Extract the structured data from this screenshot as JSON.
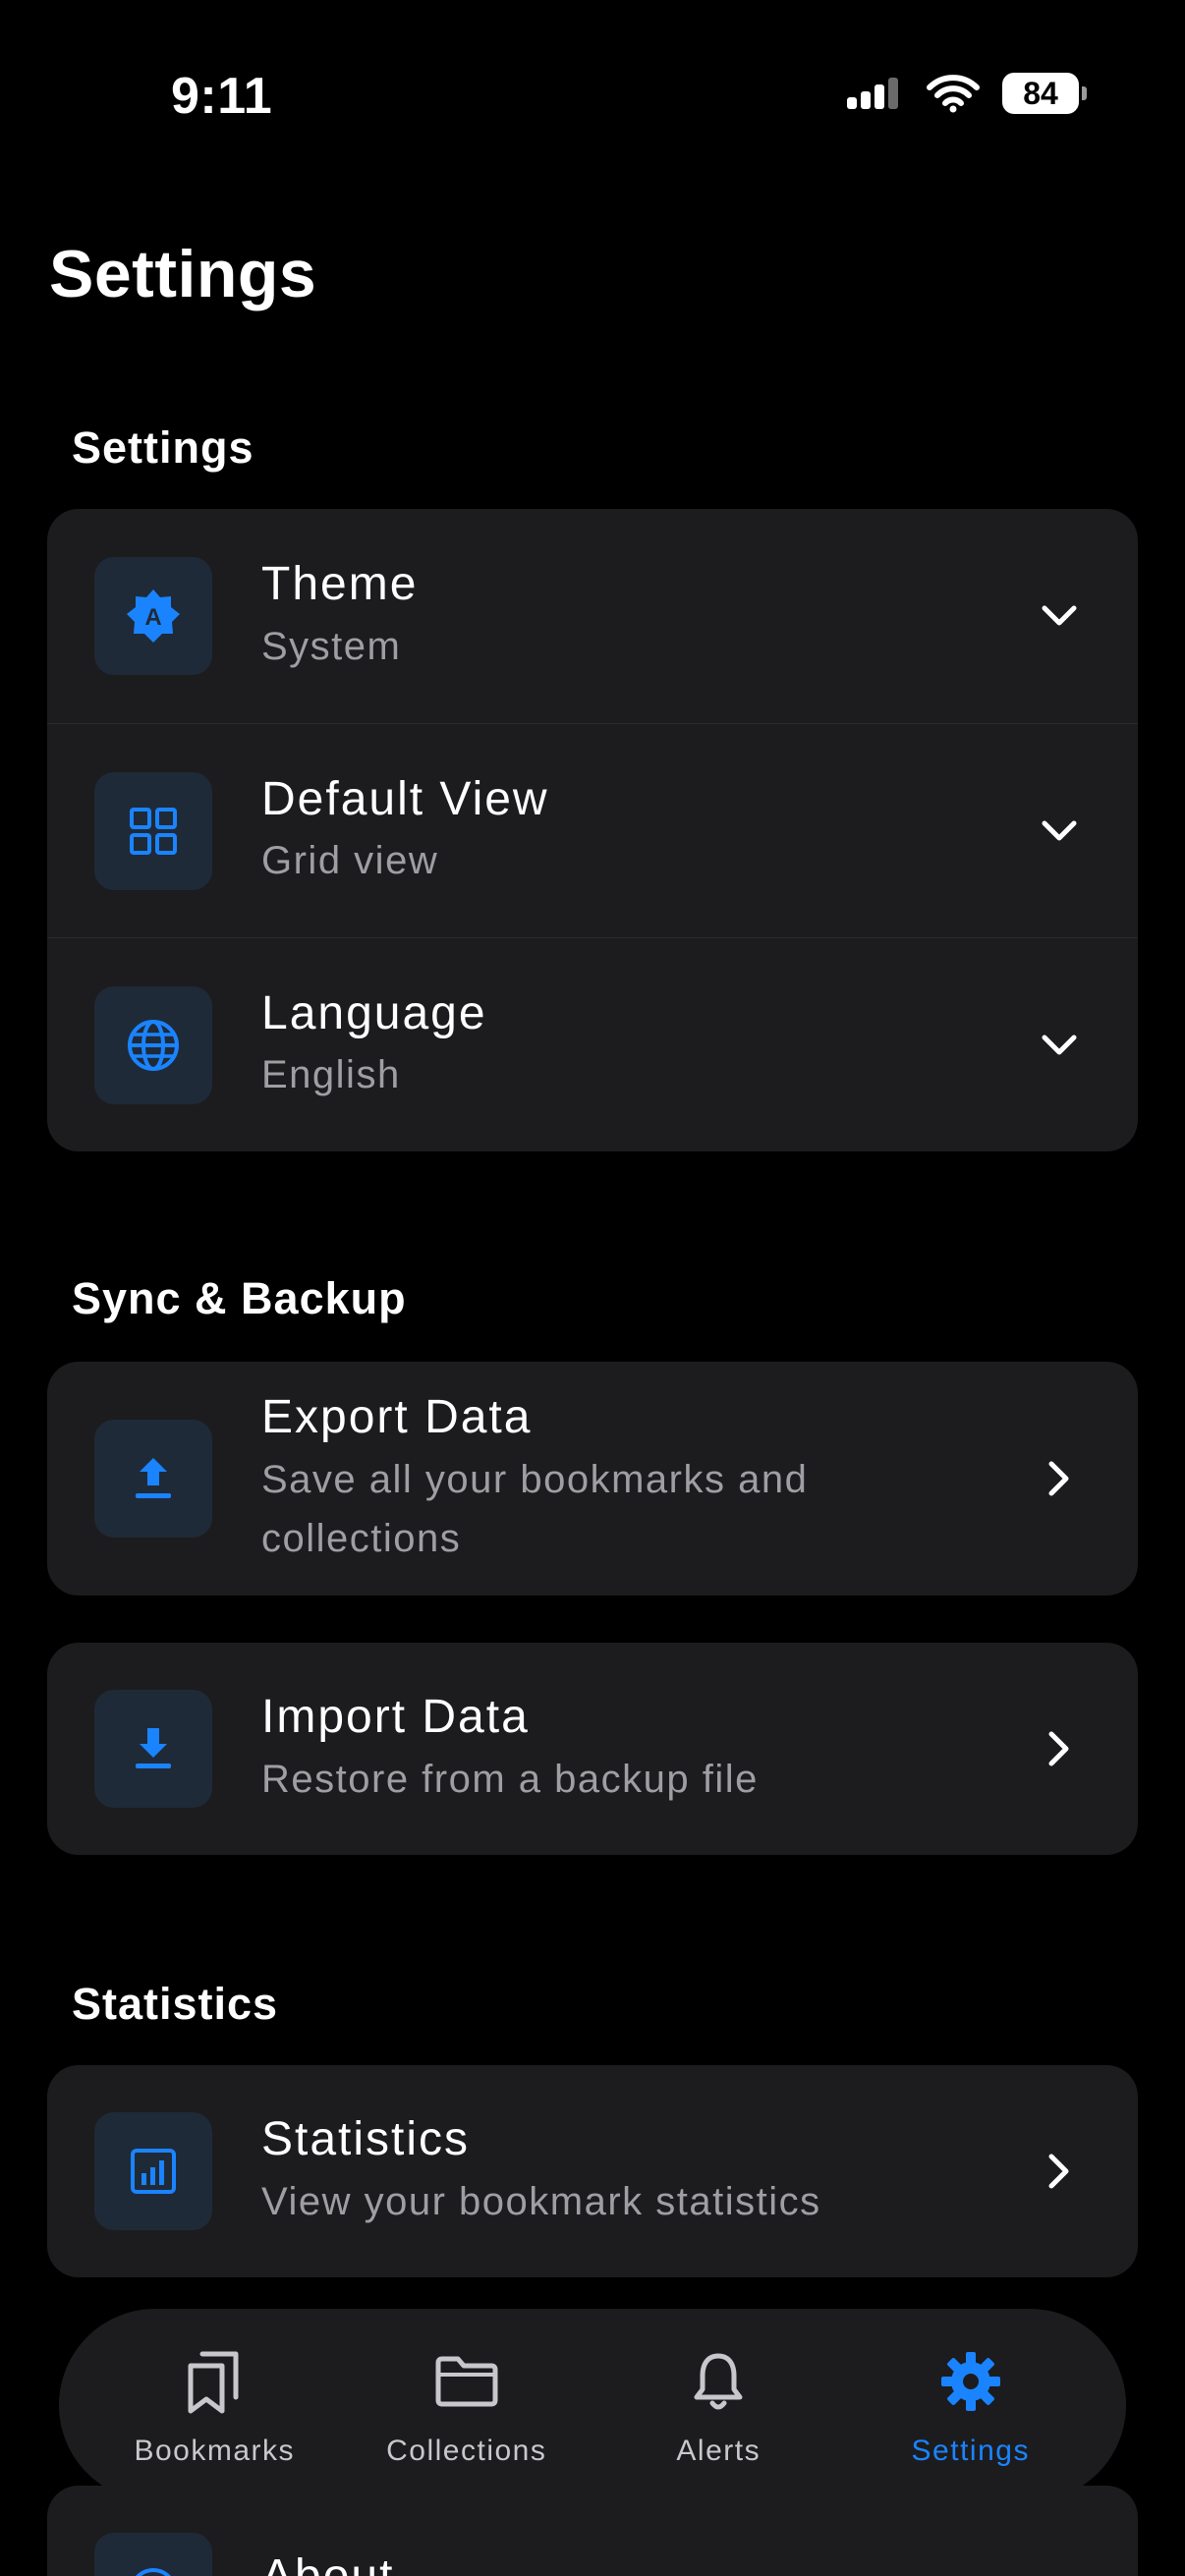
{
  "status_bar": {
    "time": "9:11",
    "battery": "84"
  },
  "page_title": "Settings",
  "sections": {
    "general": {
      "header": "Settings",
      "items": [
        {
          "title": "Theme",
          "value": "System",
          "icon": "theme-icon"
        },
        {
          "title": "Default View",
          "value": "Grid view",
          "icon": "grid-icon"
        },
        {
          "title": "Language",
          "value": "English",
          "icon": "globe-icon"
        }
      ]
    },
    "sync": {
      "header": "Sync & Backup",
      "export": {
        "title": "Export Data",
        "subtitle": "Save all your bookmarks and collections",
        "icon": "upload-icon"
      },
      "import": {
        "title": "Import Data",
        "subtitle": "Restore from a backup file",
        "icon": "download-icon"
      }
    },
    "statistics": {
      "header": "Statistics",
      "item": {
        "title": "Statistics",
        "subtitle": "View your bookmark statistics",
        "icon": "chart-icon"
      }
    },
    "about": {
      "title": "About"
    }
  },
  "tabbar": {
    "tabs": [
      {
        "label": "Bookmarks",
        "icon": "bookmarks-icon"
      },
      {
        "label": "Collections",
        "icon": "folder-icon"
      },
      {
        "label": "Alerts",
        "icon": "bell-icon"
      },
      {
        "label": "Settings",
        "icon": "gear-icon",
        "active": true
      }
    ]
  },
  "colors": {
    "accent": "#1a84ff",
    "card": "#1c1c1e",
    "icon_bg": "#1f2a38",
    "background": "#000000"
  }
}
